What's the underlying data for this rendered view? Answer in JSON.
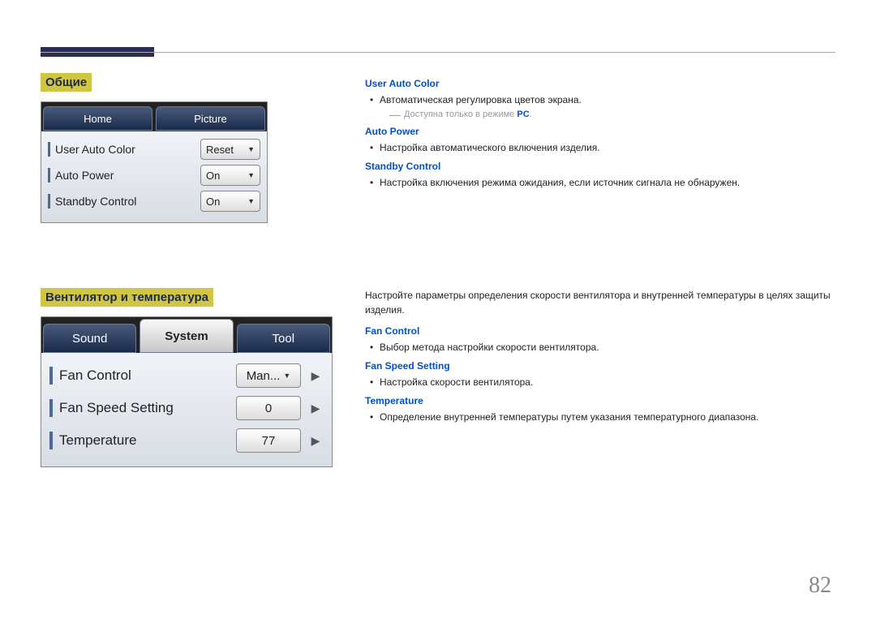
{
  "page_number": "82",
  "section1": {
    "title": "Общие",
    "tabs": {
      "home": "Home",
      "picture": "Picture"
    },
    "rows": [
      {
        "label": "User Auto Color",
        "value": "Reset"
      },
      {
        "label": "Auto Power",
        "value": "On"
      },
      {
        "label": "Standby Control",
        "value": "On"
      }
    ],
    "desc": {
      "user_auto_color": {
        "title": "User Auto Color",
        "item": "Автоматическая регулировка цветов экрана.",
        "note_prefix": "Доступна только в режиме ",
        "note_pc": "PC",
        "note_suffix": "."
      },
      "auto_power": {
        "title": "Auto Power",
        "item": "Настройка автоматического включения изделия."
      },
      "standby_control": {
        "title": "Standby Control",
        "item": "Настройка включения режима ожидания, если источник сигнала не обнаружен."
      }
    }
  },
  "section2": {
    "title": "Вентилятор и температура",
    "tabs": {
      "sound": "Sound",
      "system": "System",
      "tool": "Tool"
    },
    "rows": [
      {
        "label": "Fan Control",
        "value": "Man..."
      },
      {
        "label": "Fan Speed Setting",
        "value": "0"
      },
      {
        "label": "Temperature",
        "value": "77"
      }
    ],
    "intro": "Настройте параметры определения скорости вентилятора и внутренней температуры в целях защиты изделия.",
    "desc": {
      "fan_control": {
        "title": "Fan Control",
        "item": "Выбор метода настройки скорости вентилятора."
      },
      "fan_speed": {
        "title": "Fan Speed Setting",
        "item": "Настройка скорости вентилятора."
      },
      "temperature": {
        "title": "Temperature",
        "item": "Определение внутренней температуры путем указания температурного диапазона."
      }
    }
  }
}
